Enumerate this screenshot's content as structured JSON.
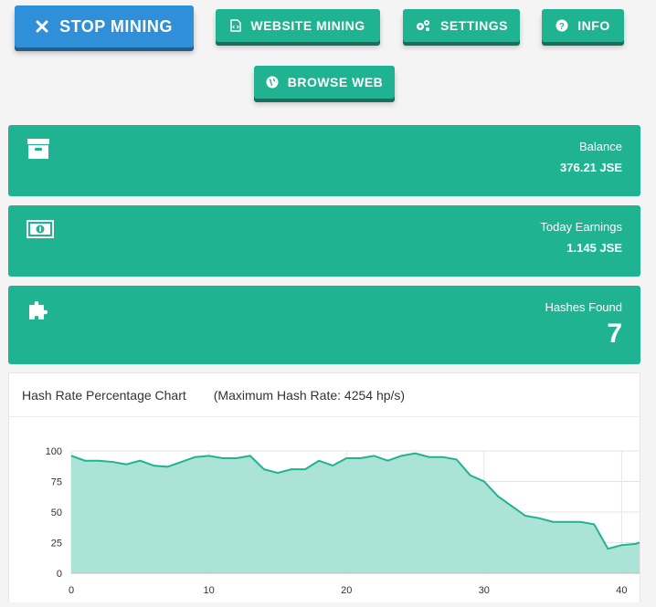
{
  "toolbar": {
    "stop_label": "STOP MINING",
    "website_label": "WEBSITE MINING",
    "settings_label": "SETTINGS",
    "info_label": "INFO",
    "browse_label": "BROWSE WEB"
  },
  "cards": {
    "balance": {
      "label": "Balance",
      "value": "376.21 JSE"
    },
    "today": {
      "label": "Today Earnings",
      "value": "1.145 JSE"
    },
    "hashes": {
      "label": "Hashes Found",
      "value": "7"
    }
  },
  "colors": {
    "accent": "#1fb391",
    "primary": "#2f8fd8",
    "chart_fill": "#a6e2d4",
    "chart_line": "#1fb391"
  },
  "chart": {
    "title": "Hash Rate Percentage Chart",
    "subtitle": "(Maximum Hash Rate: 4254 hp/s)"
  },
  "chart_data": {
    "type": "area",
    "title": "Hash Rate Percentage Chart",
    "xlabel": "",
    "ylabel": "",
    "xlim": [
      0,
      41.3
    ],
    "ylim": [
      0,
      100
    ],
    "xticks": [
      0,
      10,
      20,
      30,
      40
    ],
    "yticks": [
      0,
      25,
      50,
      75,
      100
    ],
    "grid": true,
    "x": [
      0,
      1,
      2,
      3,
      4,
      5,
      6,
      7,
      8,
      9,
      10,
      11,
      12,
      13,
      14,
      15,
      16,
      17,
      18,
      19,
      20,
      21,
      22,
      23,
      24,
      25,
      26,
      27,
      28,
      29,
      30,
      31,
      32,
      33,
      34,
      35,
      36,
      37,
      38,
      39,
      40,
      41,
      41.3
    ],
    "values": [
      96,
      92,
      92,
      91,
      89,
      92,
      88,
      87,
      91,
      95,
      96,
      94,
      94,
      96,
      85,
      82,
      85,
      85,
      92,
      88,
      94,
      94,
      96,
      92,
      96,
      98,
      95,
      95,
      93,
      80,
      75,
      63,
      55,
      47,
      45,
      42,
      42,
      42,
      40,
      20,
      23,
      24,
      25
    ]
  }
}
